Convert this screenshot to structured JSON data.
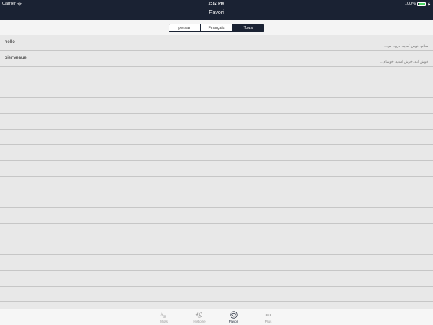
{
  "status_bar": {
    "carrier": "Carrier",
    "time": "2:32 PM",
    "battery": "100%"
  },
  "nav_bar": {
    "title": "Favori"
  },
  "segments": [
    {
      "label": "persan",
      "selected": false
    },
    {
      "label": "Français",
      "selected": false
    },
    {
      "label": "Tous",
      "selected": true
    }
  ],
  "entries": [
    {
      "word": "hello",
      "translation": "سلام. خوش آمدید. درود. می..."
    },
    {
      "word": "bienvenue",
      "translation": "خوش آمد. خوش آمدید. خوشام..."
    }
  ],
  "tab_bar": {
    "items": [
      {
        "label": "Mots",
        "icon": "letters-icon",
        "active": false
      },
      {
        "label": "Histoire",
        "icon": "history-clock-icon",
        "active": false
      },
      {
        "label": "Favori",
        "icon": "heart-circle-icon",
        "active": true
      },
      {
        "label": "Plus",
        "icon": "more-dots-icon",
        "active": false
      }
    ]
  },
  "colors": {
    "nav_background": "#1a2233",
    "list_background": "#e8e8e8",
    "battery_fill": "#4cd964"
  }
}
